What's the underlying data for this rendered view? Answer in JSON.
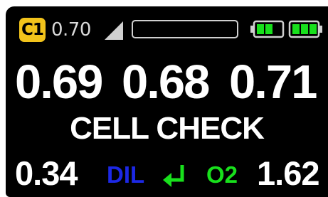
{
  "status_bar": {
    "cell_badge": "C1",
    "value": "0.70",
    "signal_icon": "signal-triangle-icon",
    "level_fraction": 0,
    "batteries": [
      {
        "icon": "battery-icon",
        "level_fraction": 0.67
      },
      {
        "icon": "battery-icon",
        "level_fraction": 1.0
      }
    ]
  },
  "readings": [
    "0.69",
    "0.68",
    "0.71"
  ],
  "mode_label": "CELL CHECK",
  "bottom_bar": {
    "left_value": "0.34",
    "dil_label": "DIL",
    "enter_icon": "enter-arrow-icon",
    "o2_label": "O2",
    "right_value": "1.62"
  },
  "colors": {
    "background": "#000000",
    "badge": "#f2c31b",
    "text": "#ffffff",
    "dil": "#1c28e6",
    "o2": "#18e01c",
    "battery": "#18e01c"
  }
}
